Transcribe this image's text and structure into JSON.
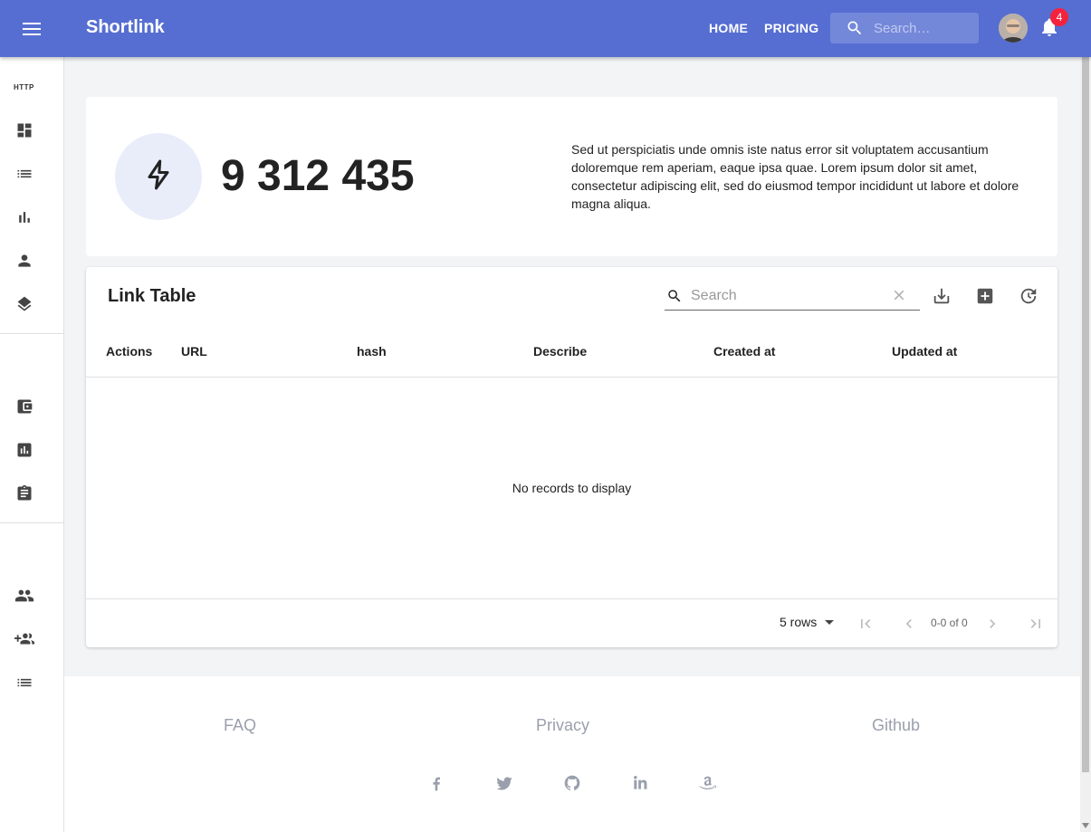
{
  "appbar": {
    "title": "Shortlink",
    "nav": [
      "HOME",
      "PRICING"
    ],
    "search_placeholder": "Search…",
    "notification_count": "4"
  },
  "sidebar": {
    "section_label": "HTTP",
    "icons_group1": [
      "dashboard-icon",
      "list-icon",
      "bar-chart-icon",
      "person-icon",
      "layers-icon"
    ],
    "icons_group2": [
      "wallet-icon",
      "assessment-icon",
      "assignment-icon"
    ],
    "icons_group3": [
      "people-icon",
      "group-add-icon",
      "list-icon"
    ]
  },
  "stat": {
    "value": "9 312 435",
    "description": "Sed ut perspiciatis unde omnis iste natus error sit voluptatem accusantium doloremque rem aperiam, eaque ipsa quae. Lorem ipsum dolor sit amet, consectetur adipiscing elit, sed do eiusmod tempor incididunt ut labore et dolore magna aliqua."
  },
  "table": {
    "title": "Link Table",
    "search_placeholder": "Search",
    "columns": [
      "Actions",
      "URL",
      "hash",
      "Describe",
      "Created at",
      "Updated at"
    ],
    "empty_text": "No records to display",
    "rows_per_page": "5 rows",
    "pagination_text": "0-0 of 0"
  },
  "footer": {
    "links": [
      "FAQ",
      "Privacy",
      "Github"
    ],
    "social": [
      "facebook-icon",
      "twitter-icon",
      "github-icon",
      "linkedin-icon",
      "amazon-icon"
    ]
  },
  "colors": {
    "primary": "#566ed2",
    "badge": "#f4223d",
    "stat_circle": "#e9edfa"
  }
}
